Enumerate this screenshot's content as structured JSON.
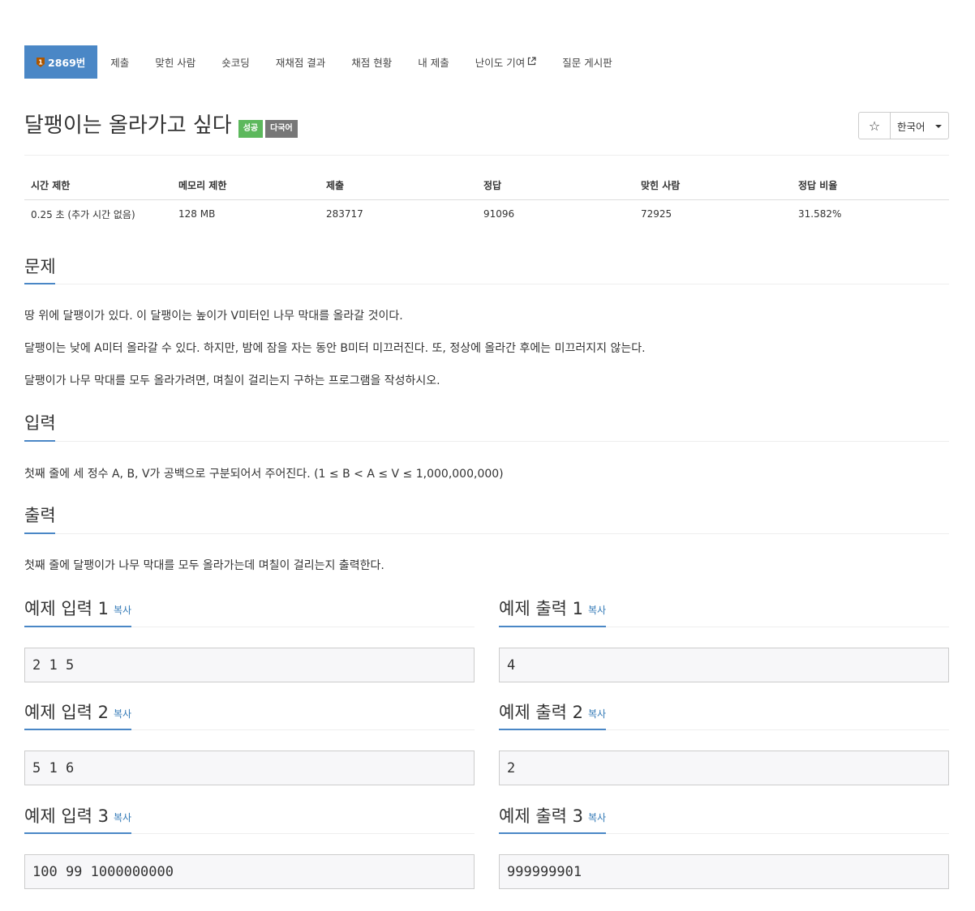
{
  "tabs": [
    {
      "label": "2869번",
      "active": true,
      "tier_number": "1"
    },
    {
      "label": "제출"
    },
    {
      "label": "맞힌 사람"
    },
    {
      "label": "숏코딩"
    },
    {
      "label": "재채점 결과"
    },
    {
      "label": "채점 현황"
    },
    {
      "label": "내 제출"
    },
    {
      "label": "난이도 기여",
      "icon": "external-link-icon"
    },
    {
      "label": "질문 게시판"
    }
  ],
  "problem": {
    "title": "달팽이는 올라가고 싶다",
    "badges": [
      "성공",
      "다국어"
    ],
    "star": "☆",
    "language": "한국어"
  },
  "info": {
    "headers": [
      "시간 제한",
      "메모리 제한",
      "제출",
      "정답",
      "맞힌 사람",
      "정답 비율"
    ],
    "values": [
      "0.25 초 (추가 시간 없음)",
      "128 MB",
      "283717",
      "91096",
      "72925",
      "31.582%"
    ]
  },
  "sections": {
    "description": {
      "title": "문제",
      "paragraphs": [
        "땅 위에 달팽이가 있다. 이 달팽이는 높이가 V미터인 나무 막대를 올라갈 것이다.",
        "달팽이는 낮에 A미터 올라갈 수 있다. 하지만, 밤에 잠을 자는 동안 B미터 미끄러진다. 또, 정상에 올라간 후에는 미끄러지지 않는다.",
        "달팽이가 나무 막대를 모두 올라가려면, 며칠이 걸리는지 구하는 프로그램을 작성하시오."
      ]
    },
    "input": {
      "title": "입력",
      "text": "첫째 줄에 세 정수 A, B, V가 공백으로 구분되어서 주어진다. (1 ≤ B < A ≤ V ≤ 1,000,000,000)"
    },
    "output": {
      "title": "출력",
      "text": "첫째 줄에 달팽이가 나무 막대를 모두 올라가는데 며칠이 걸리는지 출력한다."
    }
  },
  "samples": [
    {
      "input_title": "예제 입력 1",
      "output_title": "예제 출력 1",
      "input": "2 1 5",
      "output": "4"
    },
    {
      "input_title": "예제 입력 2",
      "output_title": "예제 출력 2",
      "input": "5 1 6",
      "output": "2"
    },
    {
      "input_title": "예제 입력 3",
      "output_title": "예제 출력 3",
      "input": "100 99 1000000000",
      "output": "999999901"
    }
  ],
  "copy_label": "복사",
  "colors": {
    "accent": "#4a87c6",
    "success": "#5cb85c",
    "multi": "#777777",
    "tier_bronze": "#ad5600",
    "link": "#337ab7"
  }
}
